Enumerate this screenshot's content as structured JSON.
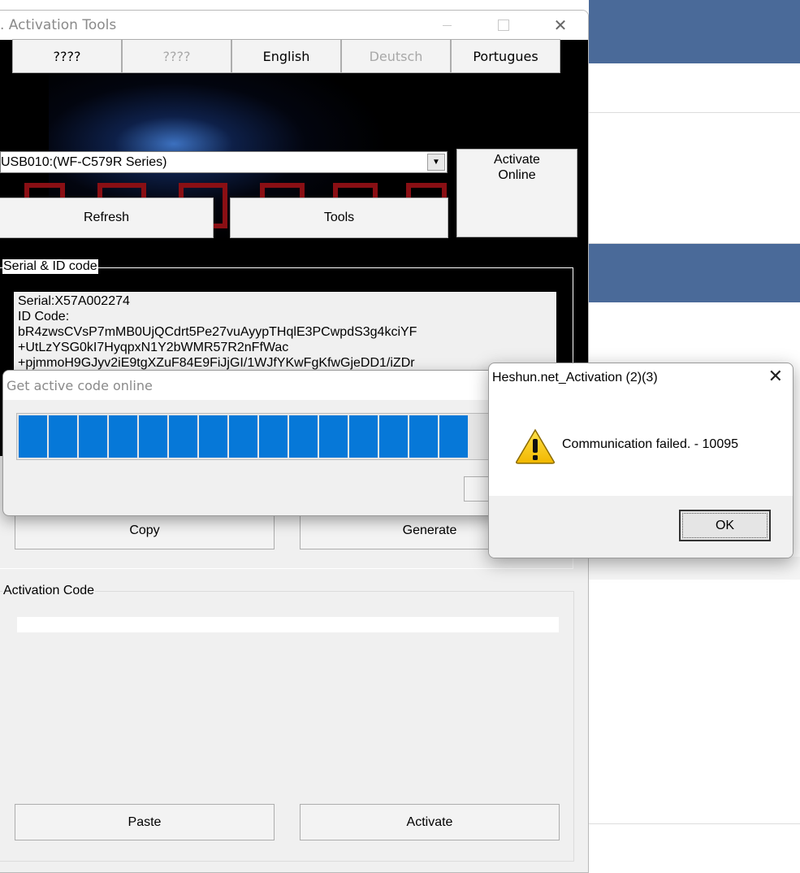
{
  "main_window": {
    "title": ". Activation Tools",
    "close_glyph": "✕"
  },
  "language_buttons": [
    {
      "label": "????",
      "enabled": true
    },
    {
      "label": "????",
      "enabled": false
    },
    {
      "label": "English",
      "enabled": true
    },
    {
      "label": "Deutsch",
      "enabled": false
    },
    {
      "label": "Portugues",
      "enabled": true
    }
  ],
  "device": {
    "selected": "USB010:(WF-C579R Series)"
  },
  "buttons": {
    "activate_online": "Activate Online",
    "refresh": "Refresh",
    "tools": "Tools",
    "copy": "Copy",
    "generate": "Generate",
    "paste": "Paste",
    "activate": "Activate"
  },
  "serial_group": {
    "legend": "Serial & ID code",
    "serial_line": "Serial:X57A002274",
    "id_label": "ID Code:",
    "id_lines": [
      "bR4zwsCVsP7mMB0UjQCdrt5Pe27vuAyypTHqlE3PCwpdS3g4kciYF",
      "+UtLzYSG0kI7HyqpxN1Y2bWMR57R2nFfWac",
      "+pjmmoH9GJyv2iE9tgXZuF84E9FiJjGI/1WJfYKwFgKfwGjeDD1/iZDr"
    ]
  },
  "activation_group": {
    "legend": "Activation Code",
    "value": ""
  },
  "progress_dialog": {
    "title": "Get active code online",
    "filled_segments": 15,
    "accent": "#0678d8"
  },
  "alert_dialog": {
    "title": "Heshun.net_Activation (2)(3)",
    "message": "Communication failed. - 10095",
    "ok": "OK",
    "close_glyph": "✕",
    "icon": "warning-icon"
  }
}
